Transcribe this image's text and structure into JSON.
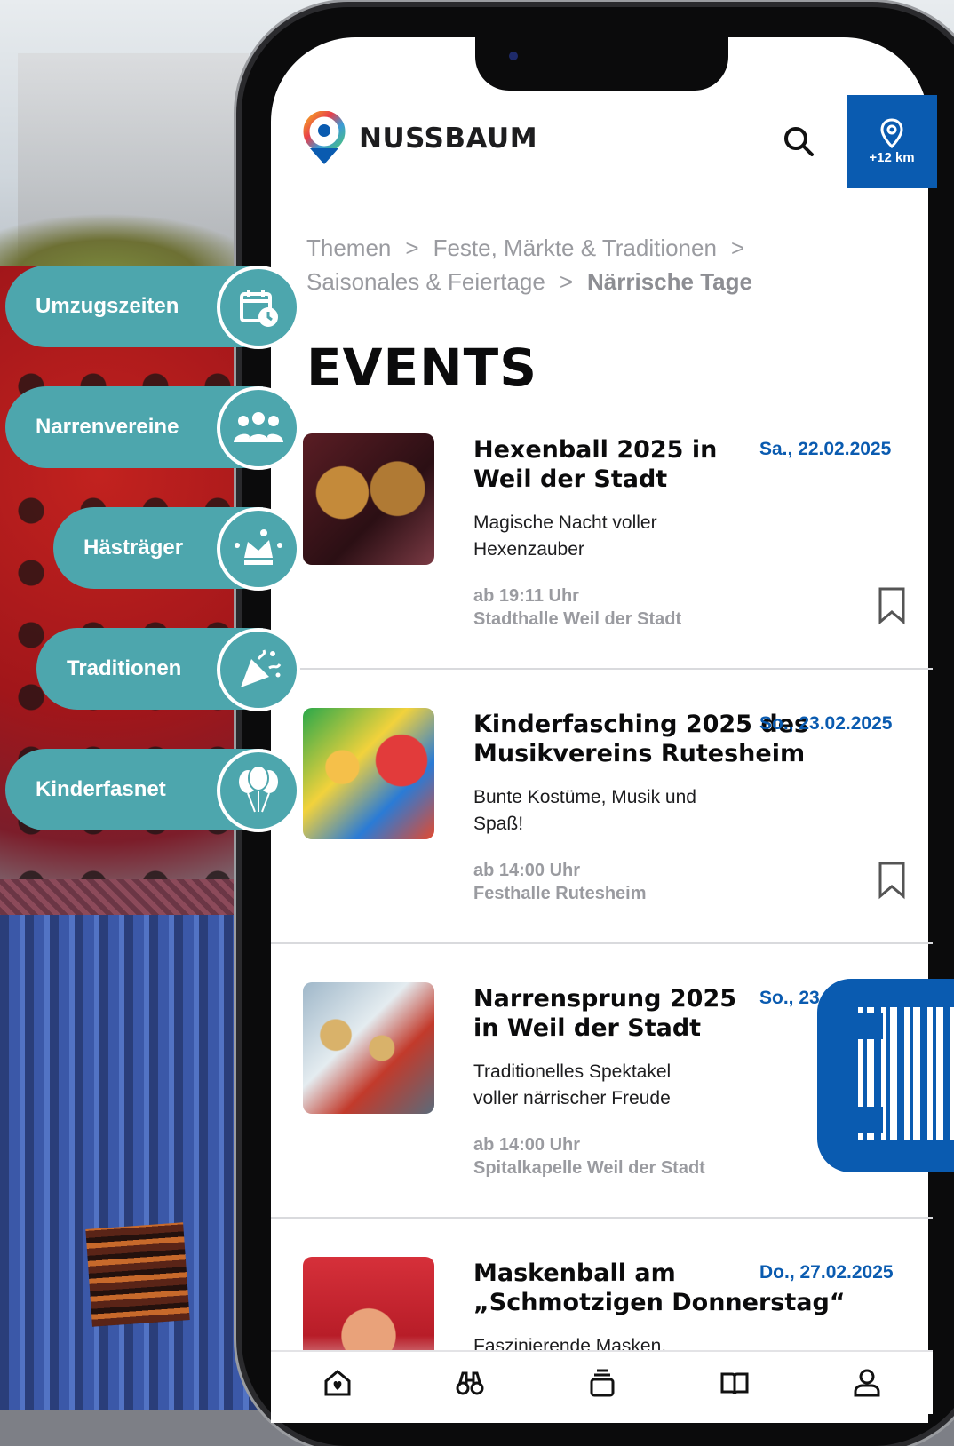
{
  "header": {
    "brand": "NUSSBAUM",
    "search_icon": "search-icon",
    "location_button": {
      "icon": "map-pin-icon",
      "label": "+12 km"
    }
  },
  "breadcrumb": {
    "items": [
      "Themen",
      "Feste, Märkte & Traditionen",
      "Saisonales & Feiertage"
    ],
    "current": "Närrische Tage",
    "separator": ">"
  },
  "page_title": "EVENTS",
  "events": [
    {
      "title": "Hexenball 2025 in Weil der Stadt",
      "date": "Sa., 22.02.2025",
      "description": "Magische Nacht voller Hexenzauber",
      "time": "ab 19:11 Uhr",
      "venue": "Stadthalle Weil der Stadt"
    },
    {
      "title": "Kinderfasching 2025 des Musikvereins Rutesheim",
      "date": "So., 23.02.2025",
      "description": "Bunte Kostüme, Musik und Spaß!",
      "time": "ab 14:00 Uhr",
      "venue": "Festhalle Rutesheim"
    },
    {
      "title": "Narrensprung 2025 in Weil der Stadt",
      "date": "So., 23",
      "description": "Traditionelles Spektakel voller närrischer Freude",
      "time": "ab 14:00 Uhr",
      "venue": "Spitalkapelle Weil der Stadt"
    },
    {
      "title": "Maskenball am „Schmotzigen Donnerstag“",
      "date": "Do., 27.02.2025",
      "description": "Faszinierende Masken, Tanz"
    }
  ],
  "side_menu": [
    {
      "label": "Umzugszeiten",
      "icon": "calendar-clock-icon"
    },
    {
      "label": "Narrenvereine",
      "icon": "group-icon"
    },
    {
      "label": "Hästräger",
      "icon": "jester-hat-icon"
    },
    {
      "label": "Traditionen",
      "icon": "party-popper-icon"
    },
    {
      "label": "Kinderfasnet",
      "icon": "balloons-icon"
    }
  ],
  "bottom_nav": [
    "home-heart-icon",
    "binoculars-icon",
    "stack-icon",
    "book-icon",
    "user-icon"
  ],
  "colors": {
    "accent_blue": "#0a5bb0",
    "teal": "#4da6ad"
  }
}
